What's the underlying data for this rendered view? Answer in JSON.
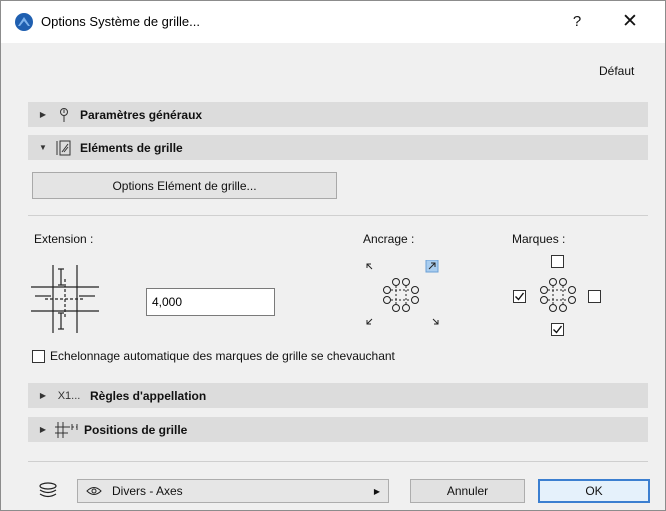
{
  "window": {
    "title": "Options Système de grille...",
    "help": "?",
    "close": "✕"
  },
  "default_link": "Défaut",
  "sections": {
    "general": "Paramètres généraux",
    "elements": "Eléments de grille",
    "naming": "Règles d'appellation",
    "positions": "Positions de grille"
  },
  "options_button": "Options Elément de grille...",
  "extension": {
    "label": "Extension :",
    "value": "4,000"
  },
  "anchor_label": "Ancrage :",
  "marks_label": "Marques :",
  "stagger_checkbox": "Echelonnage automatique des marques de grille se chevauchant",
  "naming_prefix": "X1...",
  "layer": {
    "value": "Divers - Axes"
  },
  "buttons": {
    "cancel": "Annuler",
    "ok": "OK"
  },
  "colors": {
    "accent": "#3c7fd0",
    "section_bg": "#dcdcdc",
    "dialog_bg": "#f0f0f0"
  }
}
